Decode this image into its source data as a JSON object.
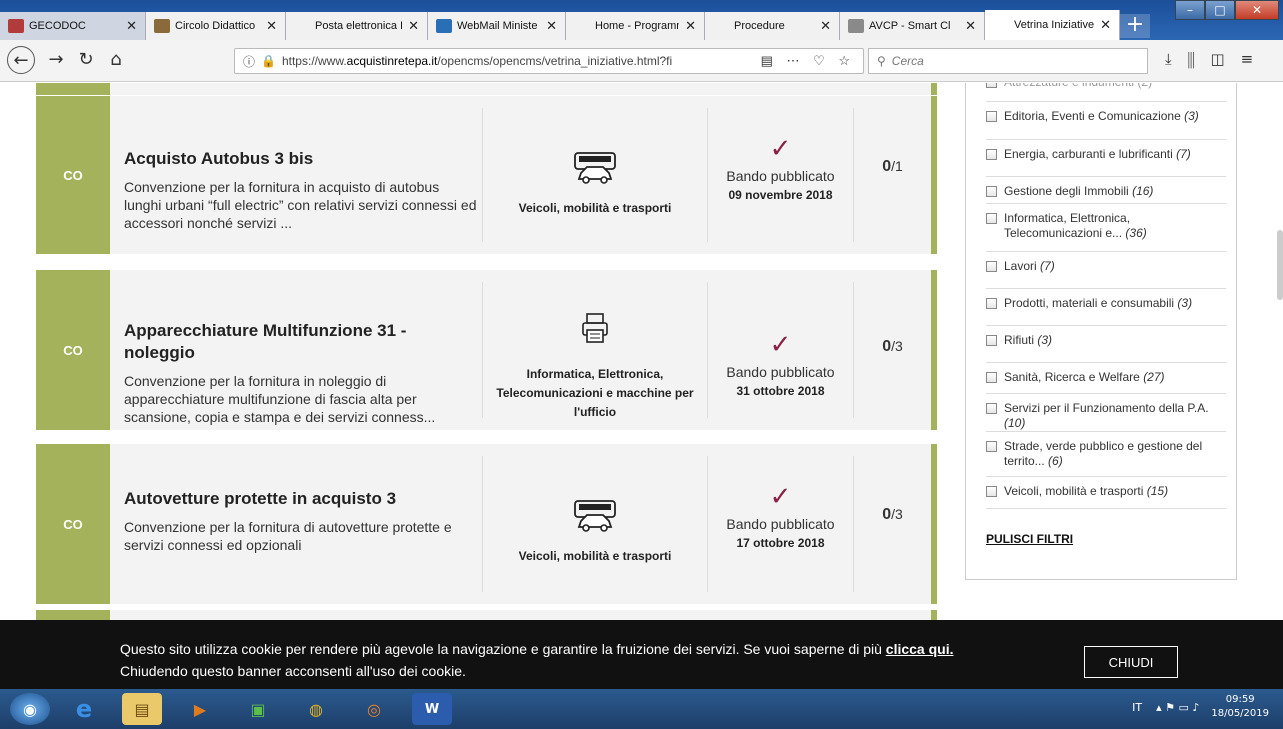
{
  "browser": {
    "tabs": [
      {
        "label": "GECODOC",
        "fav": "#b23c3c"
      },
      {
        "label": "Circolo Didattico",
        "fav": "#8a6a3a"
      },
      {
        "label": "Posta elettronica Istr",
        "fav": "#f1f1f1"
      },
      {
        "label": "WebMail Ministe",
        "fav": "#2a6fb6"
      },
      {
        "label": "Home - Programma",
        "fav": "#f1f1f1"
      },
      {
        "label": "Procedure",
        "fav": "#f1f1f1"
      },
      {
        "label": "AVCP - Smart Cl",
        "fav": "#8a8a8a"
      },
      {
        "label": "Vetrina Iniziative",
        "fav": "#ffffff"
      }
    ],
    "url_prefix": "https://www.",
    "url_domain": "acquistinretepa.it",
    "url_rest": "/opencms/opencms/vetrina_iniziative.html?fi",
    "search_placeholder": "Cerca"
  },
  "cards": [
    {
      "badge": "CO",
      "title": "Acquisto Autobus 3 bis",
      "description": "Convenzione per la fornitura in acquisto di autobus lunghi urbani “full electric” con relativi servizi connessi ed accessori nonché servizi ...",
      "category": "Veicoli, mobilità e trasporti",
      "category_icon": "vehicle-icon",
      "status": "Bando pubblicato",
      "date": "09 novembre 2018",
      "count_main": "0",
      "count_total": "/1"
    },
    {
      "badge": "CO",
      "title": "Apparecchiature Multifunzione 31 - noleggio",
      "description": "Convenzione per la fornitura in noleggio di apparecchiature multifunzione di fascia alta per scansione, copia e stampa e dei servizi conness...",
      "category": "Informatica, Elettronica, Telecomunicazioni e macchine per l'ufficio",
      "category_icon": "printer-icon",
      "status": "Bando pubblicato",
      "date": "31 ottobre 2018",
      "count_main": "0",
      "count_total": "/3"
    },
    {
      "badge": "CO",
      "title": "Autovetture protette in acquisto 3",
      "description": "Convenzione per la fornitura di autovetture protette e servizi connessi ed opzionali",
      "category": "Veicoli, mobilità e trasporti",
      "category_icon": "vehicle-icon",
      "status": "Bando pubblicato",
      "date": "17 ottobre 2018",
      "count_main": "0",
      "count_total": "/3"
    }
  ],
  "filters": [
    {
      "label": "Editoria, Eventi e Comunicazione",
      "count": "(3)"
    },
    {
      "label": "Energia, carburanti e lubrificanti",
      "count": "(7)"
    },
    {
      "label": "Gestione degli Immobili",
      "count": "(16)"
    },
    {
      "label": "Informatica, Elettronica, Telecomunicazioni e...",
      "count": "(36)"
    },
    {
      "label": "Lavori",
      "count": "(7)"
    },
    {
      "label": "Prodotti, materiali e consumabili",
      "count": "(3)"
    },
    {
      "label": "Rifiuti",
      "count": "(3)"
    },
    {
      "label": "Sanità, Ricerca e Welfare",
      "count": "(27)"
    },
    {
      "label": "Servizi per il Funzionamento della P.A.",
      "count": "(10)"
    },
    {
      "label": "Strade, verde pubblico e gestione del territo...",
      "count": "(6)"
    },
    {
      "label": "Veicoli, mobilità e trasporti",
      "count": "(15)"
    }
  ],
  "reset_label": "PULISCI FILTRI",
  "cookie": {
    "text1": "Questo sito utilizza cookie per rendere più agevole la navigazione e garantire la fruizione dei servizi. Se vuoi saperne di più ",
    "link": "clicca qui.",
    "text2": "Chiudendo questo banner acconsenti all'uso dei cookie.",
    "button": "CHIUDI"
  },
  "taskbar": {
    "lang": "IT",
    "time": "09:59",
    "date": "18/05/2019"
  },
  "colors": {
    "accent": "#a4b35b",
    "check": "#8b2046"
  }
}
